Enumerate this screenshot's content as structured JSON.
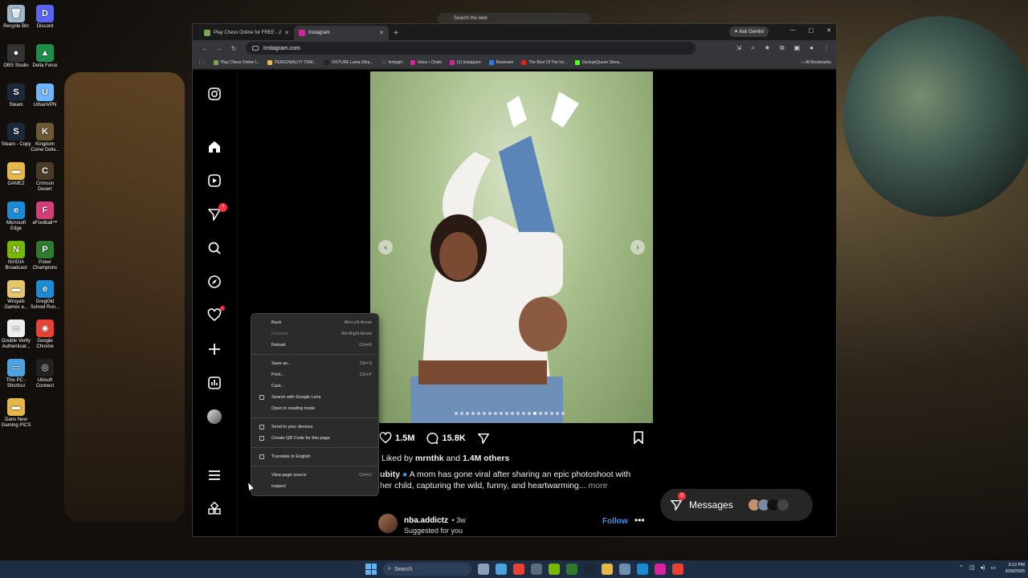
{
  "desktop": {
    "icons": [
      {
        "label": "Recycle Bin",
        "color": "#9fb7c9",
        "glyph": "🗑"
      },
      {
        "label": "Discord",
        "color": "#5865f2",
        "glyph": "D"
      },
      {
        "label": "OBS Studio",
        "color": "#333333",
        "glyph": "●"
      },
      {
        "label": "Delta Force",
        "color": "#1d8f4a",
        "glyph": "▲"
      },
      {
        "label": "Steam",
        "color": "#1b2838",
        "glyph": "S"
      },
      {
        "label": "UrbanVPN",
        "color": "#6fb4ff",
        "glyph": "U"
      },
      {
        "label": "Steam - Copy",
        "color": "#1b2838",
        "glyph": "S"
      },
      {
        "label": "Kingdom Come Deliv...",
        "color": "#6d5a34",
        "glyph": "K"
      },
      {
        "label": "GAMEZ",
        "color": "#e6b84a",
        "glyph": "▬"
      },
      {
        "label": "Crimson Desert",
        "color": "#4a3a2a",
        "glyph": "C"
      },
      {
        "label": "Microsoft Edge",
        "color": "#1b8bd6",
        "glyph": "e"
      },
      {
        "label": "eFootball™",
        "color": "#d43c7a",
        "glyph": "F"
      },
      {
        "label": "NVIDIA Broadcast",
        "color": "#76b900",
        "glyph": "N"
      },
      {
        "label": "Poker Champions",
        "color": "#2e7a2e",
        "glyph": "P"
      },
      {
        "label": "Wroyals Games a...",
        "color": "#e6c66a",
        "glyph": "▬"
      },
      {
        "label": "GregOld School Run...",
        "color": "#1b8bd6",
        "glyph": "e"
      },
      {
        "label": "Double Verify Authenticat...",
        "color": "#eeeeee",
        "glyph": "▭"
      },
      {
        "label": "Google Chrome",
        "color": "#e94235",
        "glyph": "◉"
      },
      {
        "label": "This PC - Shortcut",
        "color": "#4aa3df",
        "glyph": "▭"
      },
      {
        "label": "Ubisoft Connect",
        "color": "#222222",
        "glyph": "◎"
      },
      {
        "label": "Dans New Gaming PICS",
        "color": "#e6b84a",
        "glyph": "▬"
      }
    ]
  },
  "top_search": {
    "placeholder": "Search the web"
  },
  "browser": {
    "tabs": [
      {
        "label": "Play Chess Online for FREE - 2",
        "icon_color": "#7fa650",
        "active": false
      },
      {
        "label": "Instagram",
        "icon_color": "#d6249f",
        "active": true
      }
    ],
    "new_tab": "+",
    "gemini_label": "Ask Gemini",
    "url": "instagram.com",
    "bookmarks": [
      {
        "label": "Play Chess Online f...",
        "color": "#7fa650"
      },
      {
        "label": "PERSONALITY TRAI...",
        "color": "#e6b84a"
      },
      {
        "label": "VIXTURE Luma Ultra...",
        "color": "#222222"
      },
      {
        "label": "fentygirl",
        "color": "#444444"
      },
      {
        "label": "Inbox • Chats",
        "color": "#d6249f"
      },
      {
        "label": "(1) Instagram",
        "color": "#d6249f"
      },
      {
        "label": "Restream",
        "color": "#2b7de9"
      },
      {
        "label": "The Best Of The Int...",
        "color": "#e62117"
      },
      {
        "label": "DeJeanQueen Strea...",
        "color": "#53fc18"
      }
    ],
    "all_bookmarks": "All Bookmarks"
  },
  "instagram": {
    "sidebar": [
      "instagram-logo",
      "home",
      "reels",
      "messages",
      "search",
      "explore",
      "notifications",
      "create",
      "dashboard",
      "profile",
      "menu",
      "more-apps"
    ],
    "messages_badge": "7",
    "post": {
      "likes": "1.5M",
      "comments": "15.8K",
      "liked_by_prefix": "Liked by ",
      "liked_by_user": "mrnthk",
      "liked_by_mid": " and ",
      "liked_by_others": "1.4M others",
      "caption_user": "ubity",
      "caption_text": "A mom has gone viral after sharing an epic photoshoot with her child, capturing the wild, funny, and heartwarming...",
      "more": "more",
      "carousel_total": 20,
      "carousel_active": 14
    },
    "suggested": {
      "username": "nba.addictz",
      "age": "• 3w",
      "subtitle": "Suggested for you",
      "follow": "Follow"
    },
    "messages_pill": {
      "label": "Messages",
      "badge": "5"
    }
  },
  "context_menu": {
    "groups": [
      [
        {
          "label": "Back",
          "shortcut": "Alt+Left Arrow",
          "disabled": false,
          "icon": false
        },
        {
          "label": "Forward",
          "shortcut": "Alt+Right Arrow",
          "disabled": true,
          "icon": false
        },
        {
          "label": "Reload",
          "shortcut": "Ctrl+R",
          "disabled": false,
          "icon": false
        }
      ],
      [
        {
          "label": "Save as...",
          "shortcut": "Ctrl+S",
          "disabled": false,
          "icon": false
        },
        {
          "label": "Print...",
          "shortcut": "Ctrl+P",
          "disabled": false,
          "icon": false
        },
        {
          "label": "Cast...",
          "shortcut": "",
          "disabled": false,
          "icon": false
        },
        {
          "label": "Search with Google Lens",
          "shortcut": "",
          "disabled": false,
          "icon": true
        },
        {
          "label": "Open in reading mode",
          "shortcut": "",
          "disabled": false,
          "icon": false
        }
      ],
      [
        {
          "label": "Send to your devices",
          "shortcut": "",
          "disabled": false,
          "icon": true
        },
        {
          "label": "Create QR Code for this page",
          "shortcut": "",
          "disabled": false,
          "icon": true
        }
      ],
      [
        {
          "label": "Translate to English",
          "shortcut": "",
          "disabled": false,
          "icon": true
        }
      ],
      [
        {
          "label": "View page source",
          "shortcut": "Ctrl+U",
          "disabled": false,
          "icon": false
        },
        {
          "label": "Inspect",
          "shortcut": "",
          "disabled": false,
          "icon": false
        }
      ]
    ]
  },
  "taskbar": {
    "search_placeholder": "Search",
    "apps": [
      "#8aa0b8",
      "#4aa3df",
      "#e94235",
      "#5a6b7d",
      "#76b900",
      "#2e7a2e",
      "#1b2838",
      "#e6b84a",
      "#6d8fb0",
      "#1b8bd6",
      "#d6249f",
      "#e94235"
    ],
    "time": "3:12 PM",
    "date": "3/29/2025"
  }
}
